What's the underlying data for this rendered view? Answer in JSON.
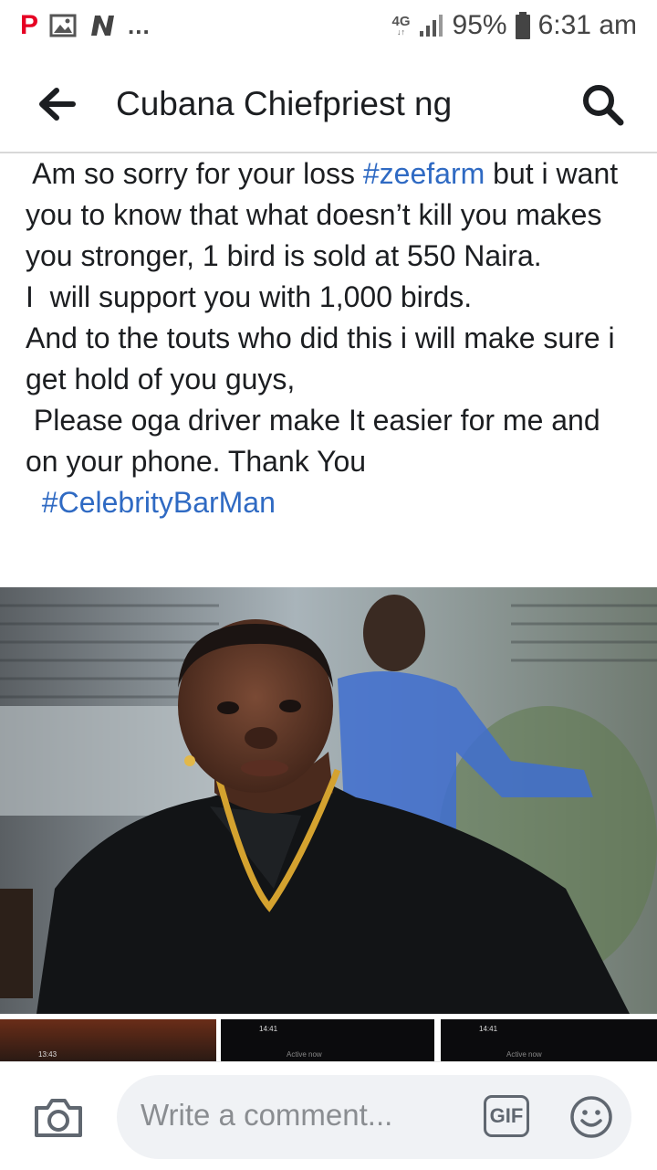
{
  "status_bar": {
    "app_p": "P",
    "more": "...",
    "network": "4G",
    "battery": "95%",
    "time": "6:31 am"
  },
  "header": {
    "title": "Cubana Chiefpriest ng",
    "back_icon": "arrow-left-icon",
    "search_icon": "search-icon"
  },
  "post": {
    "line1_pre": " Am so sorry for your loss ",
    "line1_tag": "#zeefarm",
    "line1_post": " but i want you to know that what doesn’t kill you makes you stronger, 1 bird is sold at 550 Naira.",
    "line2": "I  will support you with 1,000 birds.",
    "line3": "And to the touts who did this i will make sure i get hold of you guys,",
    "line4": " Please oga driver make It easier for me and on your phone. Thank You",
    "hashtag": "  #CelebrityBarMan"
  },
  "thumbnails": [
    {
      "time": "13:43"
    },
    {
      "time": "14:41",
      "subtitle": "Active now"
    },
    {
      "time": "14:41",
      "subtitle": "Active now"
    }
  ],
  "comment_bar": {
    "camera_icon": "camera-icon",
    "placeholder": "Write a comment...",
    "gif_label": "GIF",
    "emoji_icon": "smiley-icon"
  },
  "colors": {
    "link": "#2f6ac3",
    "text": "#1c1e21",
    "comment_bg": "#f0f2f5"
  }
}
